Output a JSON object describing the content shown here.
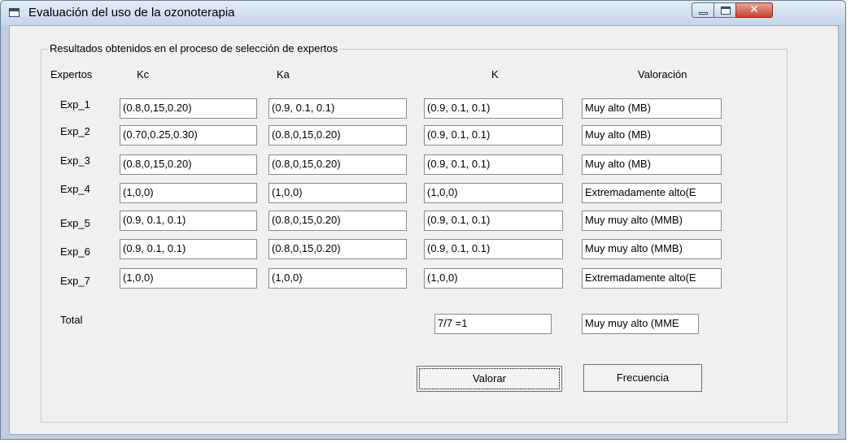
{
  "window": {
    "title": "Evaluación del uso de la ozonoterapia"
  },
  "groupbox": {
    "label": "Resultados obtenidos en el proceso de selección de expertos"
  },
  "headers": {
    "expertos": "Expertos",
    "kc": "Kc",
    "ka": "Ka",
    "k": "K",
    "valoracion": "Valoración"
  },
  "rows": [
    {
      "name": "Exp_1",
      "kc": "(0.8,0,15,0.20)",
      "ka": "(0.9, 0.1, 0.1)",
      "k": "(0.9, 0.1, 0.1)",
      "valoracion": "Muy alto (MB)"
    },
    {
      "name": "Exp_2",
      "kc": "(0.70,0.25,0.30)",
      "ka": "(0.8,0,15,0.20)",
      "k": "(0.9, 0.1, 0.1)",
      "valoracion": "Muy alto (MB)"
    },
    {
      "name": "Exp_3",
      "kc": "(0.8,0,15,0.20)",
      "ka": "(0.8,0,15,0.20)",
      "k": "(0.9, 0.1, 0.1)",
      "valoracion": "Muy alto (MB)"
    },
    {
      "name": "Exp_4",
      "kc": "(1,0,0)",
      "ka": "(1,0,0)",
      "k": "(1,0,0)",
      "valoracion": "Extremadamente alto(E"
    },
    {
      "name": "Exp_5",
      "kc": "(0.9, 0.1, 0.1)",
      "ka": "(0.8,0,15,0.20)",
      "k": "(0.9, 0.1, 0.1)",
      "valoracion": "Muy muy alto (MMB)"
    },
    {
      "name": "Exp_6",
      "kc": "(0.9, 0.1, 0.1)",
      "ka": "(0.8,0,15,0.20)",
      "k": "(0.9, 0.1, 0.1)",
      "valoracion": "Muy muy alto (MMB)"
    },
    {
      "name": "Exp_7",
      "kc": "(1,0,0)",
      "ka": "(1,0,0)",
      "k": "(1,0,0)",
      "valoracion": "Extremadamente alto(E"
    }
  ],
  "total": {
    "label": "Total",
    "k": "7/7 =1",
    "valoracion": "Muy muy alto (MME"
  },
  "buttons": {
    "valorar": "Valorar",
    "frecuencia": "Frecuencia"
  }
}
